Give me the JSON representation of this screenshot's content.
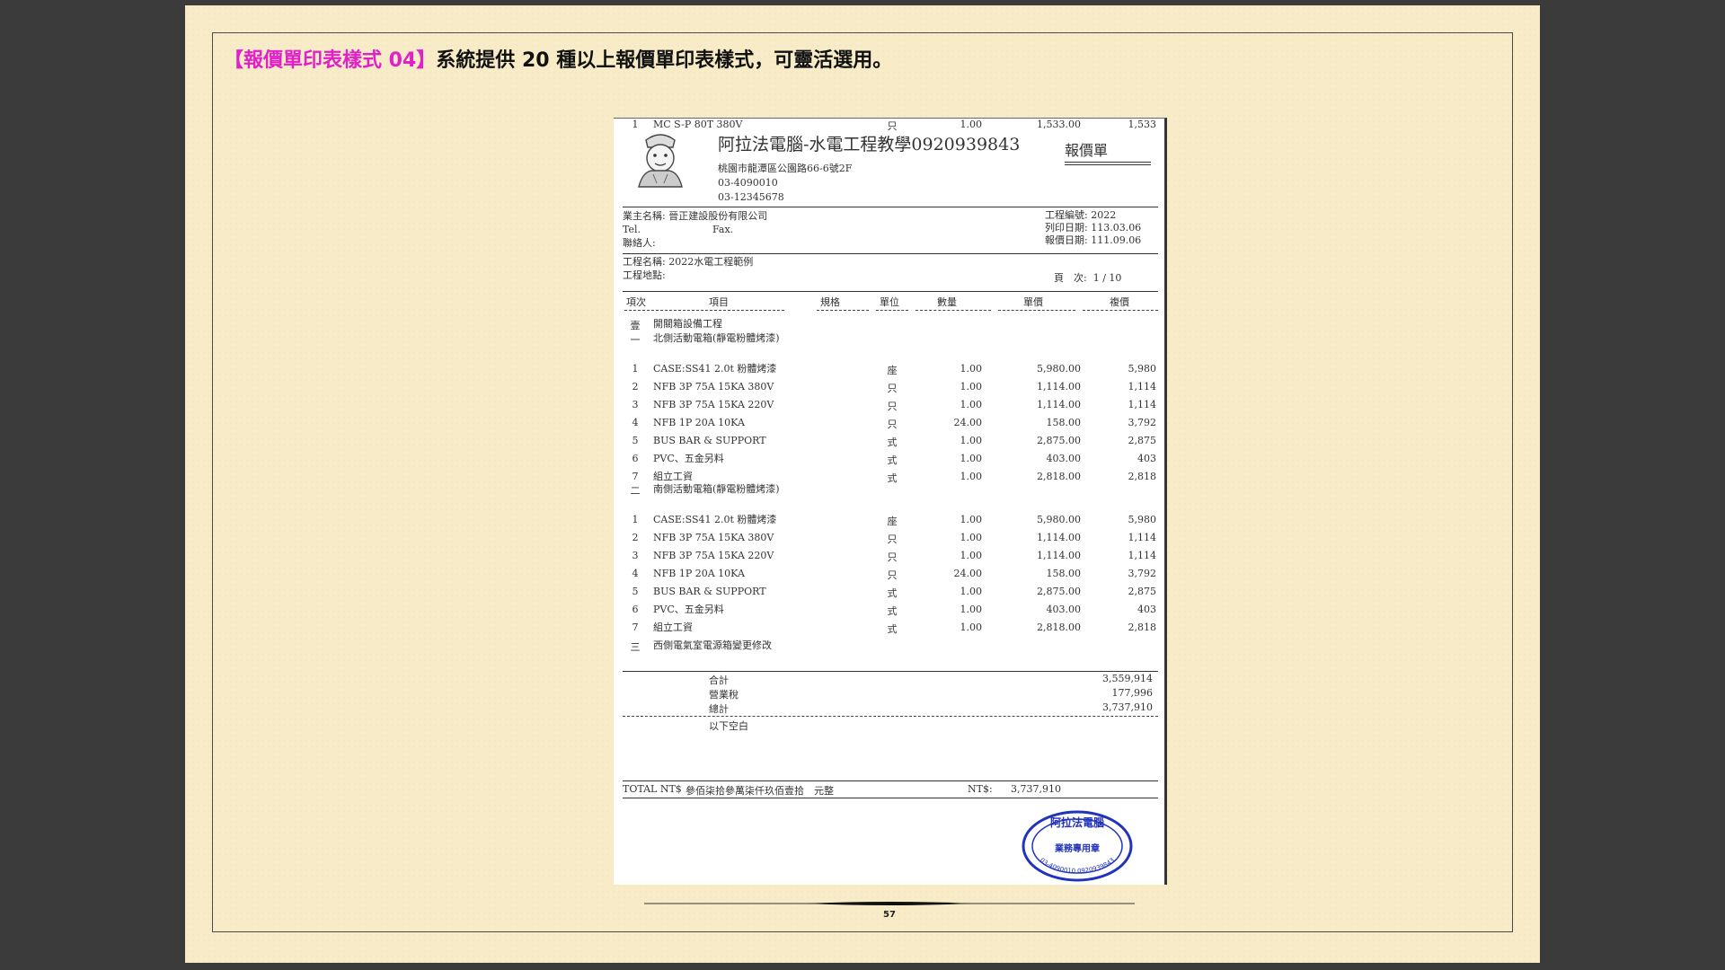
{
  "heading": {
    "tag": "【報價單印表樣式 04】",
    "text": "系統提供 20 種以上報價單印表樣式，可靈活選用。"
  },
  "doc": {
    "company_name": "阿拉法電腦-水電工程教學0920939843",
    "address": "桃園市龍潭區公園路66-6號2F",
    "phone1": "03-4090010",
    "phone2": "03-12345678",
    "doc_type": "報價單",
    "client_label": "業主名稱: 晉正建設股份有限公司",
    "tel_label": "Tel.",
    "fax_label": "Fax.",
    "contact_label": "聯絡人:",
    "project_no": "工程編號: 2022",
    "print_date": "列印日期: 113.03.06",
    "quote_date": "報價日期: 111.09.06",
    "project_name": "工程名稱: 2022水電工程範例",
    "project_site": "工程地點:",
    "page_label": "頁　次:",
    "page_value": "1 / 10",
    "columns": {
      "no": "項次",
      "item": "項目",
      "spec": "規格",
      "unit": "單位",
      "qty": "數量",
      "price": "單價",
      "amount": "複價"
    },
    "rows": [
      {
        "no": "壹",
        "item": "開關箱設備工程",
        "unit": "",
        "qty": "",
        "price": "",
        "amount": ""
      },
      {
        "no": "一",
        "item": "北側活動電箱(靜電粉體烤漆)",
        "unit": "",
        "qty": "",
        "price": "",
        "amount": "",
        "tall": true
      },
      {
        "no": "1",
        "item": "CASE:SS41 2.0t 粉體烤漆",
        "unit": "座",
        "qty": "1.00",
        "price": "5,980.00",
        "amount": "5,980"
      },
      {
        "no": "2",
        "item": "NFB 3P 75A 15KA 380V",
        "unit": "只",
        "qty": "1.00",
        "price": "1,114.00",
        "amount": "1,114"
      },
      {
        "no": "3",
        "item": "NFB 3P 75A 15KA 220V",
        "unit": "只",
        "qty": "1.00",
        "price": "1,114.00",
        "amount": "1,114"
      },
      {
        "no": "4",
        "item": "NFB 1P 20A 10KA",
        "unit": "只",
        "qty": "24.00",
        "price": "158.00",
        "amount": "3,792"
      },
      {
        "no": "5",
        "item": "BUS BAR & SUPPORT",
        "unit": "式",
        "qty": "1.00",
        "price": "2,875.00",
        "amount": "2,875"
      },
      {
        "no": "6",
        "item": "PVC、五金另料",
        "unit": "式",
        "qty": "1.00",
        "price": "403.00",
        "amount": "403"
      },
      {
        "no": "7",
        "item": "組立工資",
        "unit": "式",
        "qty": "1.00",
        "price": "2,818.00",
        "amount": "2,818"
      },
      {
        "no": "二",
        "item": "南側活動電箱(靜電粉體烤漆)",
        "unit": "",
        "qty": "",
        "price": "",
        "amount": "",
        "tall": true
      },
      {
        "no": "1",
        "item": "CASE:SS41 2.0t 粉體烤漆",
        "unit": "座",
        "qty": "1.00",
        "price": "5,980.00",
        "amount": "5,980"
      },
      {
        "no": "2",
        "item": "NFB 3P 75A 15KA 380V",
        "unit": "只",
        "qty": "1.00",
        "price": "1,114.00",
        "amount": "1,114"
      },
      {
        "no": "3",
        "item": "NFB 3P 75A 15KA 220V",
        "unit": "只",
        "qty": "1.00",
        "price": "1,114.00",
        "amount": "1,114"
      },
      {
        "no": "4",
        "item": "NFB 1P 20A 10KA",
        "unit": "只",
        "qty": "24.00",
        "price": "158.00",
        "amount": "3,792"
      },
      {
        "no": "5",
        "item": "BUS BAR & SUPPORT",
        "unit": "式",
        "qty": "1.00",
        "price": "2,875.00",
        "amount": "2,875"
      },
      {
        "no": "6",
        "item": "PVC、五金另料",
        "unit": "式",
        "qty": "1.00",
        "price": "403.00",
        "amount": "403"
      },
      {
        "no": "7",
        "item": "組立工資",
        "unit": "式",
        "qty": "1.00",
        "price": "2,818.00",
        "amount": "2,818"
      },
      {
        "no": "三",
        "item": "西側電氣室電源箱變更修改",
        "unit": "",
        "qty": "",
        "price": "",
        "amount": ""
      },
      {
        "no": "1",
        "item": "MC S-P 80T 380V",
        "unit": "只",
        "qty": "1.00",
        "price": "1,533.00",
        "amount": "1,533"
      }
    ],
    "subtotal_label": "合計",
    "subtotal": "3,559,914",
    "tax_label": "營業稅",
    "tax": "177,996",
    "total_label": "總計",
    "total": "3,737,910",
    "blank_note": "以下空白",
    "total_nt_label": "TOTAL NT$",
    "total_in_words": "參佰柒拾參萬柒仟玖佰壹拾　元整",
    "nt_label": "NT$:",
    "nt_value": "3,737,910",
    "stamp_top": "阿拉法電腦",
    "stamp_mid": "業務專用章",
    "stamp_ring": "03-4090010 0920939843"
  },
  "footer": {
    "page_number": "57"
  }
}
